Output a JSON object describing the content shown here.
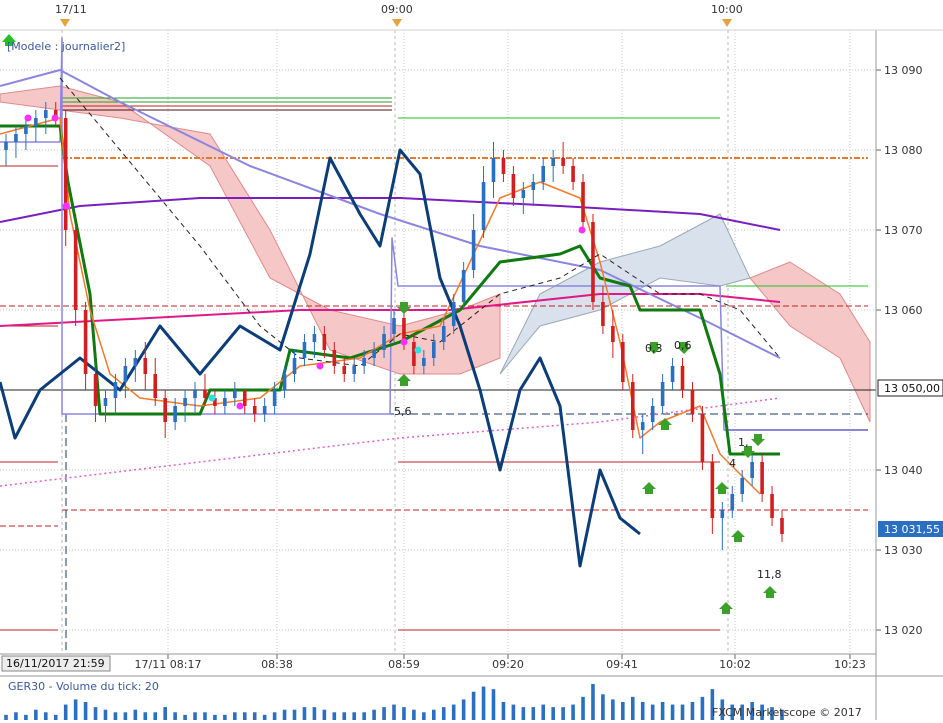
{
  "app": {
    "model_label": "[Modele : journalier2]",
    "volume_label": "GER30 - Volume du tick: 20",
    "watermark": "FXCM Marketscope © 2017"
  },
  "colors": {
    "bull": "#2a6fc2",
    "bear": "#d21e1e",
    "kijun": "#0f7a0f",
    "chikou": "#0b3d78",
    "tenkan": "#f07b2c",
    "cloud_bear": "#f6c7c7",
    "cloud_bull": "#d9e2ec",
    "ma_purple": "#7a1fbf",
    "ma_magenta": "#e0188a",
    "ma_lavender": "#8a86e0",
    "grid": "#c8c8c8",
    "volume": "#2a6fc2"
  },
  "chart_data": {
    "type": "candlestick",
    "symbol": "GER30",
    "y_ticks": [
      "13 090",
      "13 080",
      "13 070",
      "13 060",
      "13 040",
      "13 030",
      "13 020"
    ],
    "ylim": [
      13017,
      13095
    ],
    "x_ticks": [
      "17/11 08:17",
      "08:38",
      "08:59",
      "09:20",
      "09:41",
      "10:02",
      "10:23"
    ],
    "x_start_label": "16/11/2017 21:59",
    "top_markers": [
      "17/11",
      "09:00",
      "10:00"
    ],
    "current_price_label": "13 031,55",
    "crosshair_price_label": "13 050,00",
    "crosshair_price": 13050,
    "current_price": 13031.55,
    "annotations": [
      "5,6",
      "0,3",
      "0,6",
      "1,",
      "4",
      "11,8"
    ],
    "candles": [
      [
        13080,
        13082,
        13078,
        13081
      ],
      [
        13081,
        13083,
        13079,
        13082
      ],
      [
        13082,
        13084,
        13080,
        13083
      ],
      [
        13083,
        13085,
        13081,
        13084
      ],
      [
        13084,
        13086,
        13082,
        13085
      ],
      [
        13085,
        13086,
        13083,
        13084
      ],
      [
        13084,
        13085,
        13068,
        13070
      ],
      [
        13070,
        13072,
        13058,
        13060
      ],
      [
        13060,
        13061,
        13050,
        13052
      ],
      [
        13052,
        13054,
        13046,
        13048
      ],
      [
        13048,
        13050,
        13046,
        13049
      ],
      [
        13049,
        13052,
        13047,
        13051
      ],
      [
        13051,
        13054,
        13049,
        13053
      ],
      [
        13053,
        13055,
        13051,
        13054
      ],
      [
        13054,
        13056,
        13050,
        13052
      ],
      [
        13052,
        13054,
        13048,
        13049
      ],
      [
        13049,
        13050,
        13044,
        13046
      ],
      [
        13046,
        13049,
        13045,
        13048
      ],
      [
        13048,
        13050,
        13046,
        13049
      ],
      [
        13049,
        13051,
        13047,
        13050
      ],
      [
        13050,
        13052,
        13048,
        13049
      ],
      [
        13049,
        13050,
        13047,
        13048
      ],
      [
        13048,
        13050,
        13047,
        13049
      ],
      [
        13049,
        13051,
        13048,
        13050
      ],
      [
        13050,
        13049,
        13047,
        13048
      ],
      [
        13048,
        13049,
        13046,
        13047
      ],
      [
        13047,
        13049,
        13046,
        13048
      ],
      [
        13048,
        13051,
        13047,
        13050
      ],
      [
        13050,
        13053,
        13049,
        13052
      ],
      [
        13052,
        13055,
        13051,
        13054
      ],
      [
        13054,
        13057,
        13053,
        13056
      ],
      [
        13056,
        13058,
        13054,
        13057
      ],
      [
        13057,
        13058,
        13054,
        13055
      ],
      [
        13055,
        13056,
        13052,
        13053
      ],
      [
        13053,
        13054,
        13051,
        13052
      ],
      [
        13052,
        13054,
        13051,
        13053
      ],
      [
        13053,
        13055,
        13052,
        13054
      ],
      [
        13054,
        13056,
        13053,
        13055
      ],
      [
        13055,
        13058,
        13054,
        13057
      ],
      [
        13057,
        13060,
        13056,
        13059
      ],
      [
        13059,
        13061,
        13055,
        13056
      ],
      [
        13056,
        13057,
        13052,
        13053
      ],
      [
        13053,
        13055,
        13052,
        13054
      ],
      [
        13054,
        13057,
        13053,
        13056
      ],
      [
        13056,
        13059,
        13055,
        13058
      ],
      [
        13058,
        13062,
        13057,
        13061
      ],
      [
        13061,
        13066,
        13060,
        13065
      ],
      [
        13065,
        13072,
        13064,
        13070
      ],
      [
        13070,
        13078,
        13069,
        13076
      ],
      [
        13076,
        13081,
        13074,
        13079
      ],
      [
        13079,
        13080,
        13076,
        13077
      ],
      [
        13077,
        13078,
        13073,
        13074
      ],
      [
        13074,
        13076,
        13072,
        13075
      ],
      [
        13075,
        13077,
        13073,
        13076
      ],
      [
        13076,
        13079,
        13075,
        13078
      ],
      [
        13078,
        13080,
        13076,
        13079
      ],
      [
        13079,
        13081,
        13077,
        13078
      ],
      [
        13078,
        13079,
        13075,
        13076
      ],
      [
        13076,
        13077,
        13070,
        13071
      ],
      [
        13071,
        13072,
        13060,
        13061
      ],
      [
        13061,
        13063,
        13057,
        13058
      ],
      [
        13058,
        13060,
        13054,
        13056
      ],
      [
        13056,
        13057,
        13050,
        13051
      ],
      [
        13051,
        13052,
        13044,
        13045
      ],
      [
        13045,
        13047,
        13042,
        13046
      ],
      [
        13046,
        13049,
        13045,
        13048
      ],
      [
        13048,
        13052,
        13047,
        13051
      ],
      [
        13051,
        13054,
        13050,
        13053
      ],
      [
        13053,
        13054,
        13049,
        13050
      ],
      [
        13050,
        13051,
        13046,
        13047
      ],
      [
        13047,
        13048,
        13040,
        13041
      ],
      [
        13041,
        13042,
        13032,
        13034
      ],
      [
        13034,
        13036,
        13030,
        13035
      ],
      [
        13035,
        13038,
        13034,
        13037
      ],
      [
        13037,
        13040,
        13036,
        13039
      ],
      [
        13039,
        13042,
        13038,
        13041
      ],
      [
        13041,
        13042,
        13036,
        13037
      ],
      [
        13037,
        13038,
        13033,
        13034
      ],
      [
        13034,
        13035,
        13031,
        13032
      ]
    ],
    "volume": [
      2,
      3,
      2,
      4,
      3,
      2,
      6,
      8,
      7,
      5,
      4,
      3,
      3,
      4,
      3,
      3,
      5,
      3,
      2,
      3,
      3,
      2,
      2,
      3,
      3,
      3,
      2,
      3,
      4,
      4,
      5,
      5,
      4,
      3,
      3,
      3,
      3,
      4,
      5,
      6,
      5,
      4,
      3,
      4,
      5,
      6,
      8,
      11,
      13,
      12,
      7,
      6,
      5,
      5,
      6,
      5,
      5,
      6,
      9,
      14,
      10,
      8,
      7,
      9,
      7,
      6,
      7,
      6,
      6,
      7,
      9,
      12,
      8,
      6,
      6,
      7,
      6,
      5,
      4
    ]
  }
}
